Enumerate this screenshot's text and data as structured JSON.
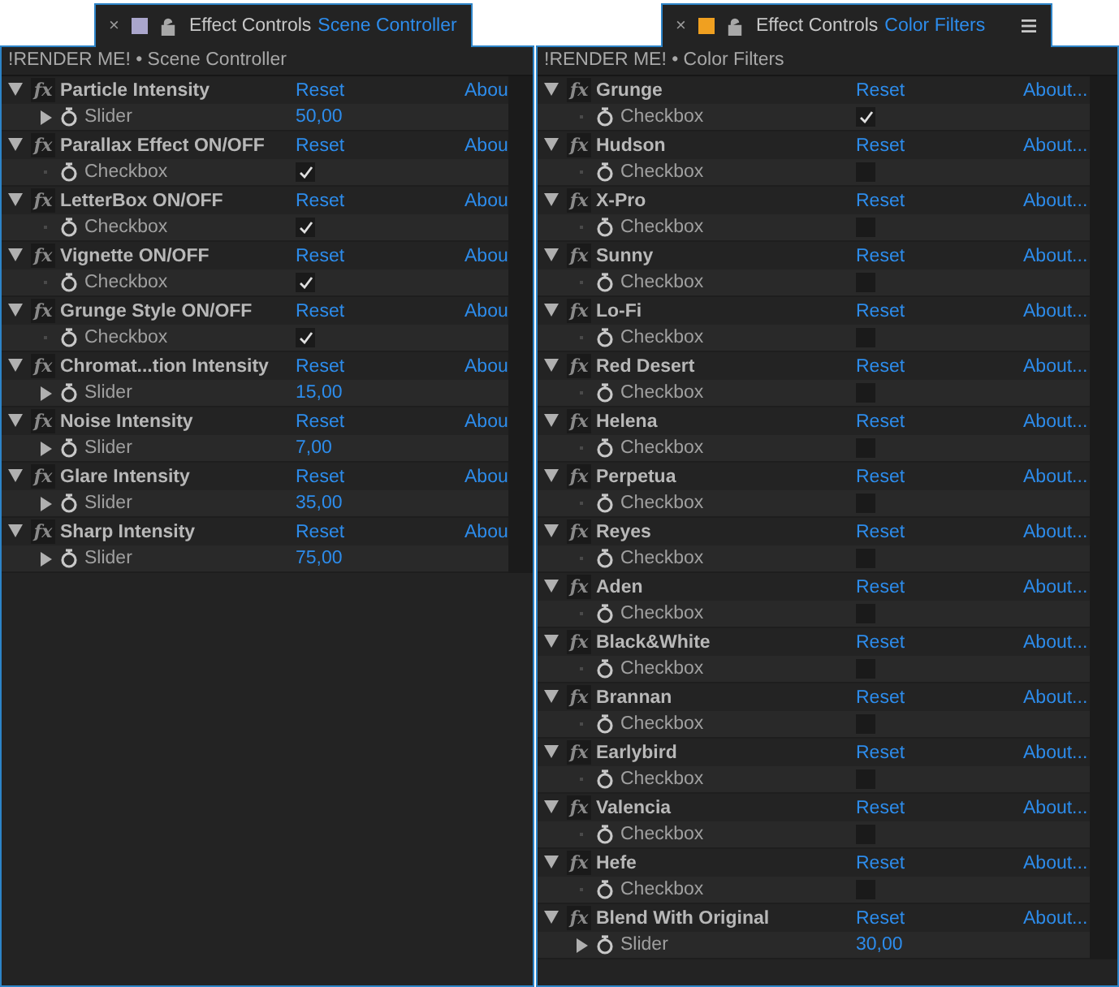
{
  "panels": [
    {
      "tab": {
        "close": "×",
        "color": "#aaa6cc",
        "title": "Effect Controls",
        "subject": "Scene Controller",
        "has_menu": false
      },
      "breadcrumb": "!RENDER ME! • Scene Controller",
      "effects": [
        {
          "badge": "fx",
          "name": "Particle Intensity",
          "reset": "Reset",
          "about": "Abou",
          "property": {
            "kind": "slider",
            "label": "Slider",
            "value": "50,00"
          }
        },
        {
          "badge": "fx",
          "name": "Parallax Effect ON/OFF",
          "reset": "Reset",
          "about": "Abou",
          "property": {
            "kind": "checkbox",
            "label": "Checkbox",
            "checked": true
          }
        },
        {
          "badge": "fx",
          "name": "LetterBox ON/OFF",
          "reset": "Reset",
          "about": "Abou",
          "property": {
            "kind": "checkbox",
            "label": "Checkbox",
            "checked": true
          }
        },
        {
          "badge": "fx",
          "name": "Vignette ON/OFF",
          "reset": "Reset",
          "about": "Abou",
          "property": {
            "kind": "checkbox",
            "label": "Checkbox",
            "checked": true
          }
        },
        {
          "badge": "fx",
          "name": "Grunge Style ON/OFF",
          "reset": "Reset",
          "about": "Abou",
          "property": {
            "kind": "checkbox",
            "label": "Checkbox",
            "checked": true
          }
        },
        {
          "badge": "fx",
          "name": "Chromat...tion Intensity",
          "reset": "Reset",
          "about": "Abou",
          "property": {
            "kind": "slider",
            "label": "Slider",
            "value": "15,00"
          }
        },
        {
          "badge": "fx",
          "name": "Noise Intensity",
          "reset": "Reset",
          "about": "Abou",
          "property": {
            "kind": "slider",
            "label": "Slider",
            "value": "7,00"
          }
        },
        {
          "badge": "fx",
          "name": "Glare Intensity",
          "reset": "Reset",
          "about": "Abou",
          "property": {
            "kind": "slider",
            "label": "Slider",
            "value": "35,00"
          }
        },
        {
          "badge": "fx",
          "name": "Sharp Intensity",
          "reset": "Reset",
          "about": "Abou",
          "property": {
            "kind": "slider",
            "label": "Slider",
            "value": "75,00"
          }
        }
      ]
    },
    {
      "tab": {
        "close": "×",
        "color": "#f0a020",
        "title": "Effect Controls",
        "subject": "Color Filters",
        "has_menu": true
      },
      "breadcrumb": "!RENDER ME! • Color Filters",
      "effects": [
        {
          "badge": "fx",
          "name": "Grunge",
          "reset": "Reset",
          "about": "About...",
          "property": {
            "kind": "checkbox",
            "label": "Checkbox",
            "checked": true
          }
        },
        {
          "badge": "fx",
          "name": "Hudson",
          "reset": "Reset",
          "about": "About...",
          "property": {
            "kind": "checkbox",
            "label": "Checkbox",
            "checked": false
          }
        },
        {
          "badge": "fx",
          "name": "X-Pro",
          "reset": "Reset",
          "about": "About...",
          "property": {
            "kind": "checkbox",
            "label": "Checkbox",
            "checked": false
          }
        },
        {
          "badge": "fx",
          "name": "Sunny",
          "reset": "Reset",
          "about": "About...",
          "property": {
            "kind": "checkbox",
            "label": "Checkbox",
            "checked": false
          }
        },
        {
          "badge": "fx",
          "name": "Lo-Fi",
          "reset": "Reset",
          "about": "About...",
          "property": {
            "kind": "checkbox",
            "label": "Checkbox",
            "checked": false
          }
        },
        {
          "badge": "fx",
          "name": "Red Desert",
          "reset": "Reset",
          "about": "About...",
          "property": {
            "kind": "checkbox",
            "label": "Checkbox",
            "checked": false
          }
        },
        {
          "badge": "fx",
          "name": "Helena",
          "reset": "Reset",
          "about": "About...",
          "property": {
            "kind": "checkbox",
            "label": "Checkbox",
            "checked": false
          }
        },
        {
          "badge": "fx",
          "name": "Perpetua",
          "reset": "Reset",
          "about": "About...",
          "property": {
            "kind": "checkbox",
            "label": "Checkbox",
            "checked": false
          }
        },
        {
          "badge": "fx",
          "name": "Reyes",
          "reset": "Reset",
          "about": "About...",
          "property": {
            "kind": "checkbox",
            "label": "Checkbox",
            "checked": false
          }
        },
        {
          "badge": "fx",
          "name": "Aden",
          "reset": "Reset",
          "about": "About...",
          "property": {
            "kind": "checkbox",
            "label": "Checkbox",
            "checked": false
          }
        },
        {
          "badge": "fx",
          "name": "Black&White",
          "reset": "Reset",
          "about": "About...",
          "property": {
            "kind": "checkbox",
            "label": "Checkbox",
            "checked": false
          }
        },
        {
          "badge": "fx",
          "name": "Brannan",
          "reset": "Reset",
          "about": "About...",
          "property": {
            "kind": "checkbox",
            "label": "Checkbox",
            "checked": false
          }
        },
        {
          "badge": "fx",
          "name": "Earlybird",
          "reset": "Reset",
          "about": "About...",
          "property": {
            "kind": "checkbox",
            "label": "Checkbox",
            "checked": false
          }
        },
        {
          "badge": "fx",
          "name": "Valencia",
          "reset": "Reset",
          "about": "About...",
          "property": {
            "kind": "checkbox",
            "label": "Checkbox",
            "checked": false
          }
        },
        {
          "badge": "fx",
          "name": "Hefe",
          "reset": "Reset",
          "about": "About...",
          "property": {
            "kind": "checkbox",
            "label": "Checkbox",
            "checked": false
          }
        },
        {
          "badge": "fx",
          "name": "Blend With Original",
          "reset": "Reset",
          "about": "About...",
          "property": {
            "kind": "slider",
            "label": "Slider",
            "value": "30,00"
          }
        }
      ]
    }
  ]
}
